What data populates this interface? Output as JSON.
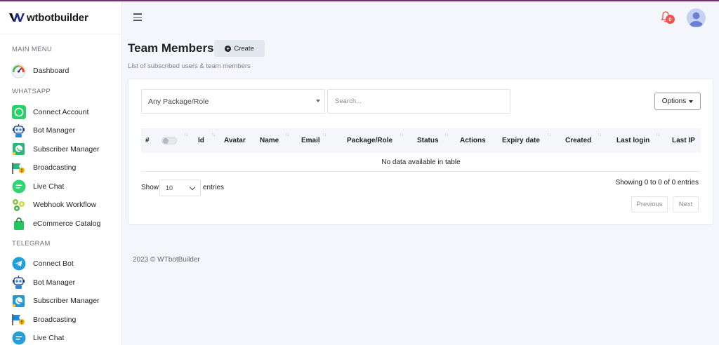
{
  "brand": {
    "name": "wtbotbuilder"
  },
  "sidebar": {
    "sections": [
      {
        "title": "MAIN MENU",
        "items": [
          {
            "label": "Dashboard",
            "icon": "dashboard-gauge-icon"
          }
        ]
      },
      {
        "title": "WHATSAPP",
        "items": [
          {
            "label": "Connect Account",
            "icon": "whatsapp-icon"
          },
          {
            "label": "Bot Manager",
            "icon": "robot-icon"
          },
          {
            "label": "Subscriber Manager",
            "icon": "subscriber-phone-icon"
          },
          {
            "label": "Broadcasting",
            "icon": "broadcast-flag-icon"
          },
          {
            "label": "Live Chat",
            "icon": "chat-bubble-icon"
          },
          {
            "label": "Webhook Workflow",
            "icon": "webhook-icon"
          },
          {
            "label": "eCommerce Catalog",
            "icon": "shopping-bag-icon"
          }
        ]
      },
      {
        "title": "TELEGRAM",
        "items": [
          {
            "label": "Connect Bot",
            "icon": "telegram-icon"
          },
          {
            "label": "Bot Manager",
            "icon": "robot-icon"
          },
          {
            "label": "Subscriber Manager",
            "icon": "subscriber-phone-icon"
          },
          {
            "label": "Broadcasting",
            "icon": "broadcast-flag-icon"
          },
          {
            "label": "Live Chat",
            "icon": "chat-bubble-icon"
          }
        ]
      }
    ]
  },
  "topbar": {
    "notification_count": "0"
  },
  "page": {
    "title": "Team Members",
    "create_label": "Create",
    "subtitle": "List of subscribed users & team members"
  },
  "filters": {
    "package_select": "Any Package/Role",
    "search_placeholder": "Search...",
    "options_label": "Options"
  },
  "table": {
    "columns": [
      "#",
      "",
      "Id",
      "Avatar",
      "Name",
      "Email",
      "Package/Role",
      "Status",
      "Actions",
      "Expiry date",
      "Created",
      "Last login",
      "Last IP"
    ],
    "empty_text": "No data available in table"
  },
  "pagination": {
    "show_label": "Show",
    "page_length": "10",
    "entries_label": "entries",
    "info": "Showing 0 to 0 of 0 entries",
    "previous_label": "Previous",
    "next_label": "Next"
  },
  "footer": {
    "text": "2023 © WTbotBuilder"
  },
  "colors": {
    "accent": "#7b2a6e",
    "badge": "#ef5350",
    "background": "#f4f6fb"
  }
}
